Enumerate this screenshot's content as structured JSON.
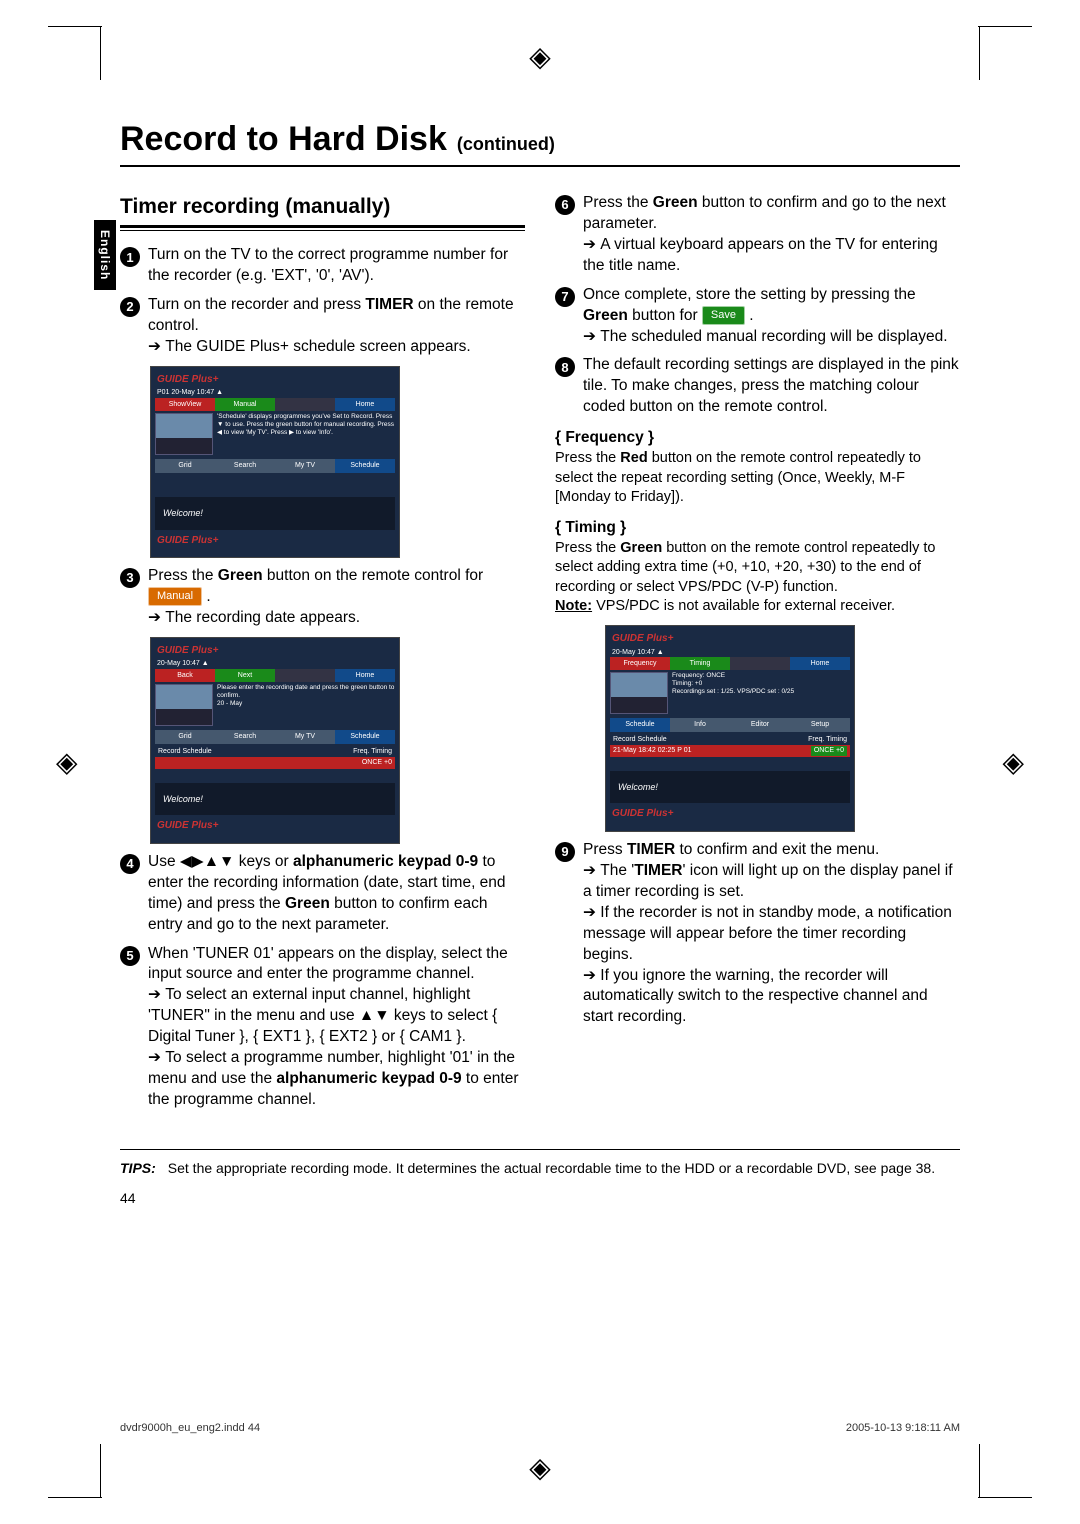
{
  "title": "Record to Hard Disk",
  "continued": "(continued)",
  "lang_tab": "English",
  "subtitle": "Timer recording (manually)",
  "left_steps": {
    "s1": "Turn on the TV to the correct programme number for the recorder (e.g. 'EXT', '0', 'AV').",
    "s2a": "Turn on the recorder and press ",
    "s2b": "TIMER",
    "s2c": " on the remote control.",
    "s2res": "The GUIDE Plus+ schedule screen appears.",
    "s3a": "Press the ",
    "s3b": "Green",
    "s3c": " button on the remote control for ",
    "s3res": "The recording date appears.",
    "s4a": "Use ◀▶▲▼ keys or ",
    "s4b": "alphanumeric keypad 0-9",
    "s4c": " to enter the recording information (date, start time, end time) and press the ",
    "s4d": "Green",
    "s4e": " button to confirm each entry and go to the next parameter.",
    "s5a": "When 'TUNER 01' appears on the display, select the input source and enter the programme channel.",
    "s5b": "To select an external input channel, highlight 'TUNER\" in the menu and use ▲▼ keys to select { Digital Tuner }, { EXT1 }, { EXT2 } or { CAM1 }.",
    "s5c": "To select a programme number, highlight '01' in the menu and use the ",
    "s5d": "alphanumeric keypad 0-9",
    "s5e": " to enter the programme channel."
  },
  "right_steps": {
    "s6a": "Press the ",
    "s6b": "Green",
    "s6c": " button to confirm and go to the next parameter.",
    "s6res": "A virtual keyboard appears on the TV for entering the title name.",
    "s7a": "Once complete, store the setting by pressing the ",
    "s7b": "Green",
    "s7c": " button for ",
    "s7res": "The scheduled manual recording will be displayed.",
    "s8": "The default recording settings are displayed in the pink tile. To make changes, press the matching colour coded button on the remote control.",
    "freq_title": "{ Frequency }",
    "freq_body_a": "Press the ",
    "freq_body_b": "Red",
    "freq_body_c": " button on the remote control repeatedly to select the repeat recording setting (Once, Weekly, M-F [Monday to Friday]).",
    "timing_title": "{ Timing }",
    "timing_a": "Press the ",
    "timing_b": "Green",
    "timing_c": " button on the remote control repeatedly to select adding extra time (+0, +10, +20, +30) to the end of recording or select VPS/PDC (V-P) function.",
    "timing_note_a": "Note:",
    "timing_note_b": " VPS/PDC is not available for external receiver.",
    "s9a": "Press ",
    "s9b": "TIMER",
    "s9c": " to confirm and exit the menu.",
    "s9res1a": "The '",
    "s9res1b": "TIMER",
    "s9res1c": "' icon will light up on the display panel if a timer recording is set.",
    "s9res2": "If the recorder is not in standby mode, a notification message will appear before the timer recording begins.",
    "s9res3": "If you ignore the warning, the recorder will automatically switch to the respective channel and start recording."
  },
  "pills": {
    "manual": "Manual",
    "save": "Save"
  },
  "screenshot1": {
    "logo": "GUIDE Plus+",
    "info": "P01   20-May  10:47 ▲",
    "tabs_top": [
      "ShowView",
      "Manual",
      "",
      "Home"
    ],
    "desc": "'Schedule' displays programmes you've Set to Record. Press ▼ to use. Press the green button for manual recording. Press ◀ to view 'My TV'. Press ▶ to view 'Info'.",
    "tabs_mid": [
      "Grid",
      "Search",
      "My TV",
      "Schedule"
    ],
    "welcome": "Welcome!"
  },
  "screenshot2": {
    "info": "20-May  10:47 ▲",
    "tabs_top": [
      "Back",
      "Next",
      "",
      "Home"
    ],
    "desc": "Please enter the recording date and press the green button to confirm.",
    "dateline": "20   -   May",
    "tabs_mid": [
      "Grid",
      "Search",
      "My TV",
      "Schedule"
    ],
    "sched_label": "Record Schedule",
    "cols": "Freq.   Timing",
    "row": "ONCE   +0",
    "welcome": "Welcome!"
  },
  "screenshot3": {
    "info": "20-May  10:47 ▲",
    "tabs_top": [
      "Frequency",
      "Timing",
      "",
      "Home"
    ],
    "desc": "Frequency: ONCE\nTiming: +0\nRecordings set :  1/25.  VPS/PDC set : 0/25",
    "tabs_mid": [
      "Schedule",
      "Info",
      "Editor",
      "Setup"
    ],
    "sched_label": "Record Schedule",
    "cols": "Freq.   Timing",
    "row_left": "21-May  18:42  02:25  P 01",
    "row_right": "ONCE   +0",
    "welcome": "Welcome!"
  },
  "tips_label": "TIPS:",
  "tips_body": "Set the appropriate recording mode. It determines the actual recordable time to the HDD or a recordable DVD, see page 38.",
  "page_num": "44",
  "footer_left": "dvdr9000h_eu_eng2.indd   44",
  "footer_right": "2005-10-13   9:18:11 AM"
}
